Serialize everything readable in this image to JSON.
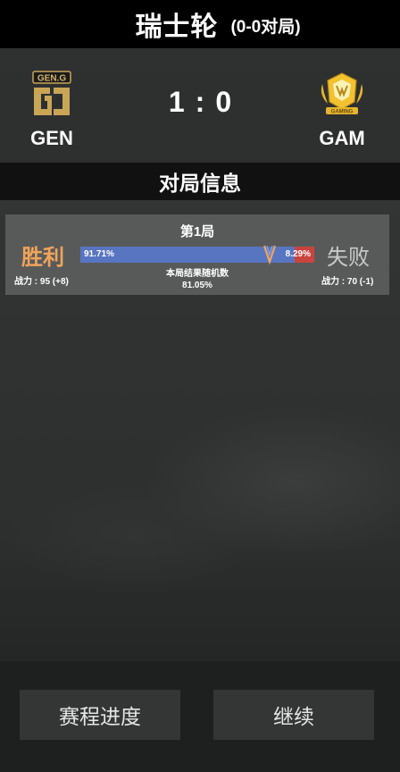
{
  "header": {
    "title": "瑞士轮",
    "subtitle": "(0-0对局)"
  },
  "match": {
    "team_left": {
      "name": "GEN",
      "logo_text": "GEN.G",
      "score": "1"
    },
    "team_right": {
      "name": "GAM",
      "logo_text": "GAMING",
      "score": "0"
    },
    "score_separator": ":"
  },
  "section_title": "对局信息",
  "rounds": [
    {
      "label": "第1局",
      "left_result": "胜利",
      "right_result": "失败",
      "left_power": "战力 : 95 (+8)",
      "right_power": "战力 : 70 (-1)",
      "left_win_pct_label": "91.71%",
      "right_win_pct_label": "8.29%",
      "left_win_fraction": 0.9171,
      "random_value_fraction": 0.8105,
      "random_label": "本局结果随机数",
      "random_value_label": "81.05%"
    }
  ],
  "colors": {
    "win": "#f0a45a",
    "lose": "#c9c9c9",
    "bar_left": "#5875c1",
    "bar_right": "#c9443f",
    "marker": "#f0a45a"
  },
  "buttons": {
    "progress": "赛程进度",
    "continue": "继续"
  }
}
